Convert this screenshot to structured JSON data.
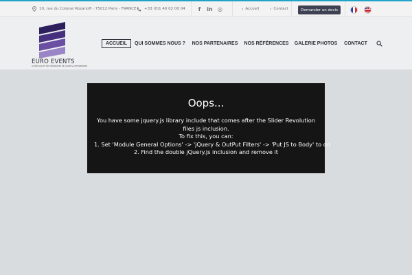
{
  "topbar": {
    "address": "10, rue du Colonel Rozanoff - 75012 Paris - FRANCE",
    "phone": "+33 (0)1 40 02 00 04",
    "social": [
      "f",
      "in",
      "◎"
    ],
    "links": [
      "Accueil",
      "Contact"
    ],
    "quote_button": "Demander un devis",
    "languages": [
      "French flag",
      "English flag"
    ]
  },
  "header": {
    "logo_name": "EURO EVENTS",
    "logo_tagline": "LE SPÉCIALISTE DES SÉMINAIRES DE CADRE & D'ENTREPRISES",
    "nav": [
      "ACCUEIL",
      "QUI SOMMES NOUS ?",
      "NOS PARTENAIRES",
      "NOS RÉFÉRENCES",
      "GALERIE PHOTOS",
      "CONTACT"
    ]
  },
  "error": {
    "title": "Oops...",
    "line1": "You have some jquery.js library include that comes after the Slider Revolution files js inclusion.",
    "line2": "To fix this, you can:",
    "line3": "1. Set 'Module General Options' -> 'jQuery & OutPut Filters' -> 'Put JS to Body' to on",
    "line4": "2. Find the double jQuery.js inclusion and remove it"
  },
  "colors": {
    "accent": "#1fa3c9",
    "quote_button": "#3d4152",
    "logo_purple": "#5a3e8f",
    "error_bg": "#151515",
    "page_bg": "#d9dcdf"
  }
}
